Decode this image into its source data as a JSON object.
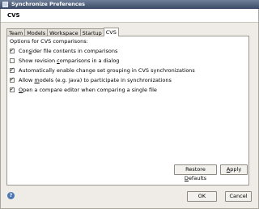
{
  "window": {
    "title": "Synchronize Preferences"
  },
  "page": {
    "title": "CVS"
  },
  "tabs": [
    {
      "label": "Team",
      "accel": ""
    },
    {
      "label": "Models",
      "accel": ""
    },
    {
      "label": "Workspace",
      "accel": ""
    },
    {
      "label": "Startup",
      "accel": ""
    },
    {
      "label": "CVS",
      "accel": ""
    }
  ],
  "cvs": {
    "intro": "Options for CVS comparisons:",
    "options": [
      {
        "pre": "Con",
        "key": "s",
        "post": "ider file contents in comparisons",
        "checked": true
      },
      {
        "pre": "Show revision ",
        "key": "c",
        "post": "omparisons in a dialog",
        "checked": false
      },
      {
        "pre": "Automatically enable change set grouping in CVS synchronizations",
        "key": "",
        "post": "",
        "checked": true
      },
      {
        "pre": "Allow ",
        "key": "m",
        "post": "odels (e.g. Java) to participate in synchronizations",
        "checked": true
      },
      {
        "pre": "",
        "key": "O",
        "post": "pen a compare editor when comparing a single file",
        "checked": true
      }
    ]
  },
  "buttons": {
    "restore_pre": "Restore ",
    "restore_key": "D",
    "restore_post": "efaults",
    "apply_pre": "",
    "apply_key": "A",
    "apply_post": "pply",
    "ok": "OK",
    "cancel": "Cancel"
  },
  "help": {
    "icon": "help-icon",
    "glyph": "?"
  }
}
